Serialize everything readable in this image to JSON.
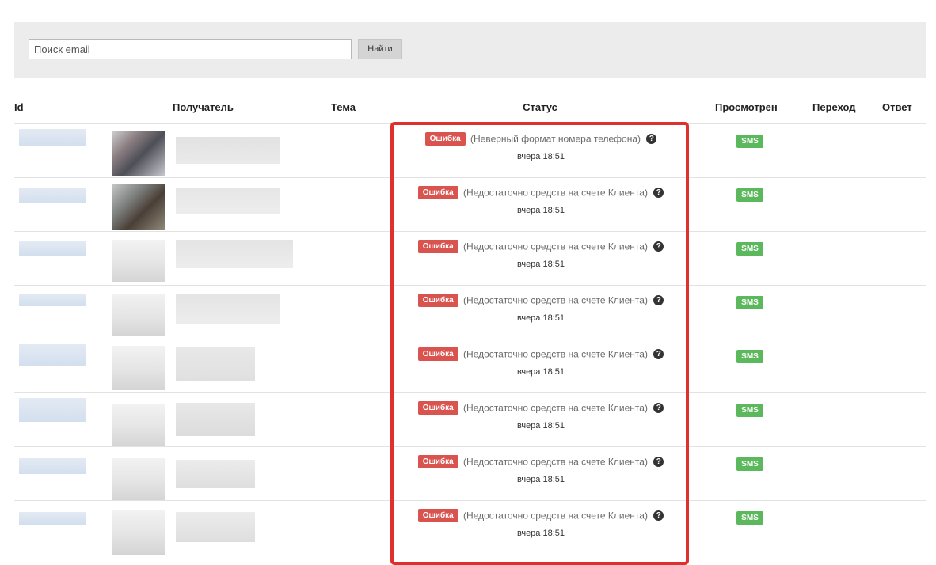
{
  "search": {
    "placeholder": "Поиск email",
    "value": "",
    "button_label": "Найти"
  },
  "table": {
    "headers": {
      "id": "Id",
      "recipient": "Получатель",
      "subject": "Тема",
      "status": "Статус",
      "viewed": "Просмотрен",
      "click": "Переход",
      "reply": "Ответ"
    },
    "rows": [
      {
        "status_badge": "Ошибка",
        "status_text": "(Неверный формат номера телефона)",
        "status_time": "вчера 18:51",
        "viewed_badge": "SMS"
      },
      {
        "status_badge": "Ошибка",
        "status_text": "(Недостаточно средств на счете Клиента)",
        "status_time": "вчера 18:51",
        "viewed_badge": "SMS"
      },
      {
        "status_badge": "Ошибка",
        "status_text": "(Недостаточно средств на счете Клиента)",
        "status_time": "вчера 18:51",
        "viewed_badge": "SMS"
      },
      {
        "status_badge": "Ошибка",
        "status_text": "(Недостаточно средств на счете Клиента)",
        "status_time": "вчера 18:51",
        "viewed_badge": "SMS"
      },
      {
        "status_badge": "Ошибка",
        "status_text": "(Недостаточно средств на счете Клиента)",
        "status_time": "вчера 18:51",
        "viewed_badge": "SMS"
      },
      {
        "status_badge": "Ошибка",
        "status_text": "(Недостаточно средств на счете Клиента)",
        "status_time": "вчера 18:51",
        "viewed_badge": "SMS"
      },
      {
        "status_badge": "Ошибка",
        "status_text": "(Недостаточно средств на счете Клиента)",
        "status_time": "вчера 18:51",
        "viewed_badge": "SMS"
      },
      {
        "status_badge": "Ошибка",
        "status_text": "(Недостаточно средств на счете Клиента)",
        "status_time": "вчера 18:51",
        "viewed_badge": "SMS"
      }
    ]
  },
  "colors": {
    "error_badge": "#d9534f",
    "sms_badge": "#5cb85c",
    "highlight_border": "#e0302e",
    "search_panel": "#ececec"
  },
  "icons": {
    "help": "question-circle-icon"
  }
}
